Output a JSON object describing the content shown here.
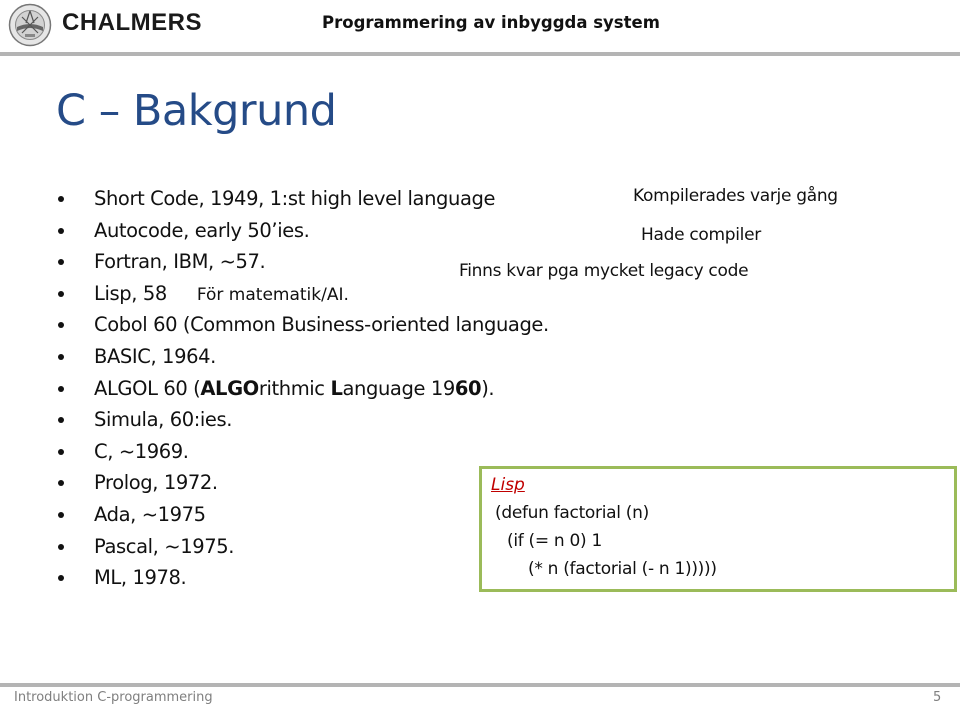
{
  "header": {
    "brand": "CHALMERS",
    "course_title": "Programmering av inbyggda system",
    "logo_icon": "chalmers-emblem-icon"
  },
  "slide": {
    "title": "C – Bakgrund",
    "bullets": [
      {
        "text": "Short Code, 1949, 1:st high level language"
      },
      {
        "text": "Autocode, early 50’ies."
      },
      {
        "text": "Fortran, IBM, ~57."
      },
      {
        "text": "Lisp, 58",
        "note": "För matematik/AI."
      },
      {
        "text": "Cobol 60 (Common Business-oriented language."
      },
      {
        "text": "BASIC, 1964."
      },
      {
        "parts": [
          "ALGOL 60 (",
          "ALGO",
          "rithmic ",
          "L",
          "anguage 19",
          "60",
          ")."
        ]
      },
      {
        "text": "Simula, 60:ies."
      },
      {
        "text": "C, ~1969."
      },
      {
        "text": "Prolog, 1972."
      },
      {
        "text": "Ada, ~1975"
      },
      {
        "text": "Pascal, ~1975."
      },
      {
        "text": "ML, 1978."
      }
    ],
    "annotations": {
      "short_code": "Kompilerades varje gång",
      "autocode": "Hade compiler",
      "fortran": "Finns kvar pga mycket legacy code"
    },
    "code_box": {
      "language": "Lisp",
      "lines": [
        "(defun factorial (n)",
        "(if (= n 0) 1",
        "(* n (factorial (- n 1)))))"
      ]
    }
  },
  "footer": {
    "left": "Introduktion C-programmering",
    "page_number": "5"
  },
  "colors": {
    "title": "#254b87",
    "code_border": "#9bbb59",
    "code_language": "#c00000",
    "bars": "#b4b4b4",
    "footer_text": "#7f7f7f"
  }
}
